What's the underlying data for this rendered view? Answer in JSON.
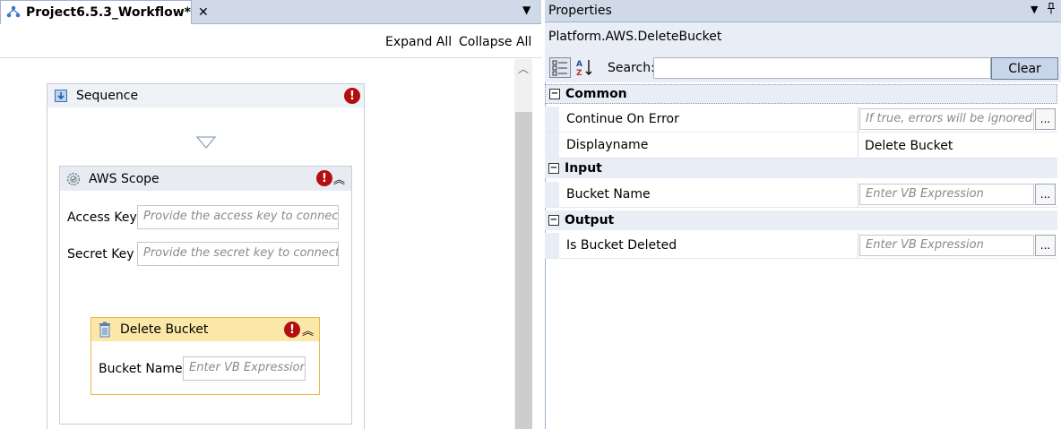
{
  "designer": {
    "tab_title": "Project6.5.3_Workflow*",
    "tab_close": "✕",
    "expand_all": "Expand All",
    "collapse_all": "Collapse All",
    "sequence": {
      "title": "Sequence",
      "error": "!"
    },
    "aws_scope": {
      "title": "AWS Scope",
      "error": "!",
      "access_key_label": "Access Key",
      "access_key_placeholder": "Provide the access key to connect",
      "secret_key_label": "Secret Key",
      "secret_key_placeholder": "Provide the secret key to connect"
    },
    "delete_bucket": {
      "title": "Delete Bucket",
      "error": "!",
      "bucket_name_label": "Bucket Name",
      "bucket_name_placeholder": "Enter VB Expression"
    }
  },
  "properties": {
    "title": "Properties",
    "object_name": "Platform.AWS.DeleteBucket",
    "search_label": "Search:",
    "search_value": "",
    "clear_label": "Clear",
    "categories": [
      {
        "name": "Common",
        "rows": [
          {
            "label": "Continue On Error",
            "value": "If true, errors will be ignored",
            "kind": "placeholder",
            "has_button": true
          },
          {
            "label": "Displayname",
            "value": "Delete Bucket",
            "kind": "plain",
            "has_button": false
          }
        ]
      },
      {
        "name": "Input",
        "rows": [
          {
            "label": "Bucket Name",
            "value": "Enter VB Expression",
            "kind": "placeholder",
            "has_button": true
          }
        ]
      },
      {
        "name": "Output",
        "rows": [
          {
            "label": "Is Bucket Deleted",
            "value": "Enter VB Expression",
            "kind": "placeholder",
            "has_button": true
          }
        ]
      }
    ]
  },
  "colors": {
    "error": "#b50e0e",
    "delete_bucket_header": "#fbe7a8",
    "delete_bucket_border": "#e6b94a",
    "pane_header": "#cfd9e8"
  }
}
